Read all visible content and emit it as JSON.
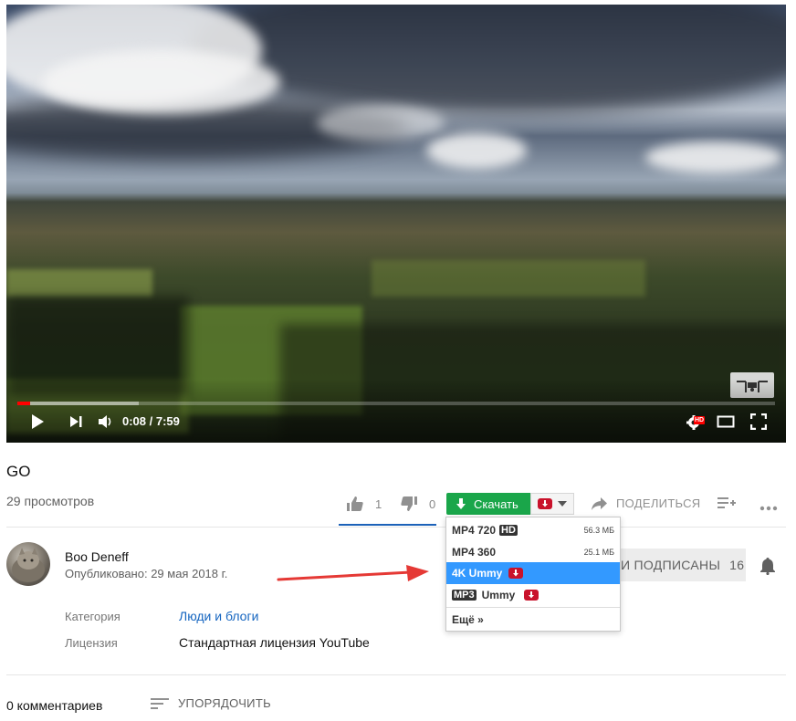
{
  "video": {
    "time_current": "0:08",
    "time_separator": " / ",
    "time_total": "7:59",
    "time_display": "0:08 / 7:59",
    "progress_played_fraction": 0.0167,
    "progress_buffered_fraction": 0.16,
    "hd_badge": "HD"
  },
  "title": "GO",
  "views": "29 просмотров",
  "likes": "1",
  "dislikes": "0",
  "download": {
    "label": "Скачать",
    "menu": [
      {
        "label": "MP4 720",
        "badge": "HD",
        "size": "56.3 МБ"
      },
      {
        "label": "MP4 360",
        "size": "25.1 МБ"
      },
      {
        "label": "4K Ummy",
        "active": true
      },
      {
        "badge": "MP3",
        "label": "Ummy"
      },
      {
        "label": "Ещё »"
      }
    ]
  },
  "share_label": "ПОДЕЛИТЬСЯ",
  "channel": {
    "name": "Boo Deneff",
    "published": "Опубликовано: 29 мая 2018 г.",
    "subscribed_label": "ВЫ ПОДПИСАНЫ",
    "subscribed_visible": "И ПОДПИСАНЫ",
    "subscriber_count": "16"
  },
  "meta": {
    "category_key": "Категория",
    "category_value": "Люди и блоги",
    "license_key": "Лицензия",
    "license_value": "Стандартная лицензия YouTube"
  },
  "comments": {
    "count_label": "0 комментариев",
    "sort_label": "УПОРЯДОЧИТЬ"
  },
  "colors": {
    "download_green": "#1aa64a",
    "ummy_red": "#c9122b",
    "menu_active": "#3399ff",
    "progress_red": "#ff0000",
    "link_blue": "#1565c0",
    "arrow_red": "#e53935"
  },
  "icons": [
    "play-icon",
    "next-icon",
    "volume-icon",
    "settings-icon",
    "miniplayer-icon",
    "fullscreen-icon",
    "like-icon",
    "dislike-icon",
    "download-arrow-icon",
    "share-icon",
    "playlist-add-icon",
    "more-icon",
    "bell-icon",
    "sort-icon"
  ]
}
